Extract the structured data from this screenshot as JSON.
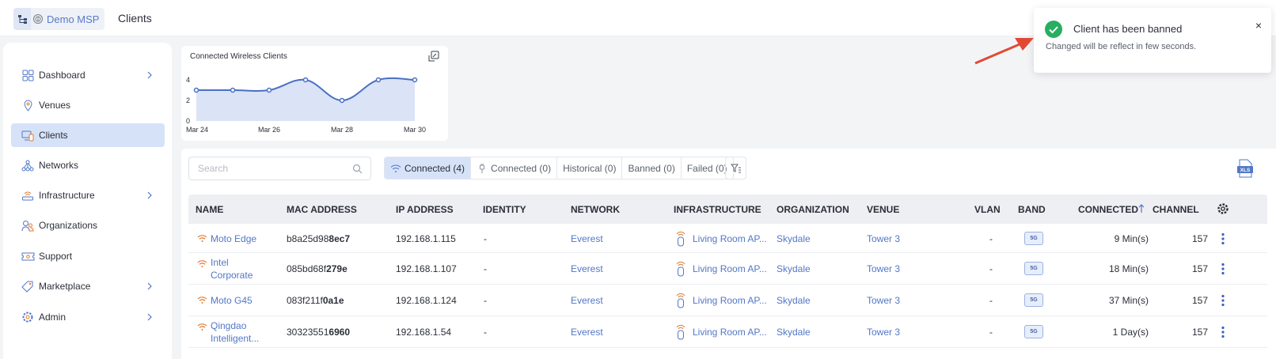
{
  "header": {
    "brand": "Demo MSP",
    "title": "Clients"
  },
  "sidebar": {
    "items": [
      {
        "label": "Dashboard",
        "icon": "dashboard-icon",
        "expandable": true
      },
      {
        "label": "Venues",
        "icon": "location-pin-icon",
        "expandable": false
      },
      {
        "label": "Clients",
        "icon": "clients-icon",
        "expandable": false,
        "active": true
      },
      {
        "label": "Networks",
        "icon": "network-icon",
        "expandable": false
      },
      {
        "label": "Infrastructure",
        "icon": "access-point-icon",
        "expandable": true
      },
      {
        "label": "Organizations",
        "icon": "organization-icon",
        "expandable": false
      },
      {
        "label": "Support",
        "icon": "support-ticket-icon",
        "expandable": false
      },
      {
        "label": "Marketplace",
        "icon": "tag-icon",
        "expandable": true
      },
      {
        "label": "Admin",
        "icon": "gear-icon",
        "expandable": true
      }
    ]
  },
  "chart_data": {
    "type": "area",
    "title": "Connected Wireless Clients",
    "x_ticks": [
      "Mar 24",
      "Mar 26",
      "Mar 28",
      "Mar 30"
    ],
    "y_ticks": [
      0,
      2,
      4
    ],
    "ylim": [
      0,
      4
    ],
    "x": [
      "Mar 24",
      "Mar 25",
      "Mar 26",
      "Mar 27",
      "Mar 28",
      "Mar 29",
      "Mar 30"
    ],
    "values": [
      3,
      3,
      3,
      4,
      2,
      4,
      4
    ],
    "color": "#4a6fc4",
    "fill": "#dbe3f6",
    "grid": false
  },
  "toolbar": {
    "search_placeholder": "Search",
    "tabs": [
      {
        "label": "Connected (4)",
        "icon": "wifi-icon",
        "active": true
      },
      {
        "label": "Connected (0)",
        "icon": "wired-plug-icon"
      },
      {
        "label": "Historical (0)"
      },
      {
        "label": "Banned (0)"
      },
      {
        "label": "Failed (0)"
      }
    ]
  },
  "table": {
    "columns": [
      "NAME",
      "MAC ADDRESS",
      "IP ADDRESS",
      "IDENTITY",
      "NETWORK",
      "INFRASTRUCTURE",
      "ORGANIZATION",
      "VENUE",
      "VLAN",
      "BAND",
      "CONNECTED",
      "CHANNEL"
    ],
    "rows": [
      {
        "name": "Moto Edge",
        "mac_prefix": "b8a25d98",
        "mac_suffix": "8ec7",
        "ip": "192.168.1.115",
        "identity": "-",
        "network": "Everest",
        "infrastructure": "Living Room AP...",
        "organization": "Skydale",
        "venue": "Tower 3",
        "vlan": "-",
        "band": "5G",
        "connected": "9 Min(s)",
        "channel": "157"
      },
      {
        "name": "Intel Corporate",
        "mac_prefix": "085bd68f",
        "mac_suffix": "279e",
        "ip": "192.168.1.107",
        "identity": "-",
        "network": "Everest",
        "infrastructure": "Living Room AP...",
        "organization": "Skydale",
        "venue": "Tower 3",
        "vlan": "-",
        "band": "5G",
        "connected": "18 Min(s)",
        "channel": "157"
      },
      {
        "name": "Moto G45",
        "mac_prefix": "083f211f",
        "mac_suffix": "0a1e",
        "ip": "192.168.1.124",
        "identity": "-",
        "network": "Everest",
        "infrastructure": "Living Room AP...",
        "organization": "Skydale",
        "venue": "Tower 3",
        "vlan": "-",
        "band": "5G",
        "connected": "37 Min(s)",
        "channel": "157"
      },
      {
        "name": "Qingdao Intelligent...",
        "mac_prefix": "30323551",
        "mac_suffix": "6960",
        "ip": "192.168.1.54",
        "identity": "-",
        "network": "Everest",
        "infrastructure": "Living Room AP...",
        "organization": "Skydale",
        "venue": "Tower 3",
        "vlan": "-",
        "band": "5G",
        "connected": "1 Day(s)",
        "channel": "157"
      }
    ]
  },
  "toast": {
    "title": "Client has been banned",
    "message": "Changed will be reflect in few seconds.",
    "status_color": "#27ae60"
  },
  "annotation": {
    "arrow_color": "#e04a35"
  }
}
